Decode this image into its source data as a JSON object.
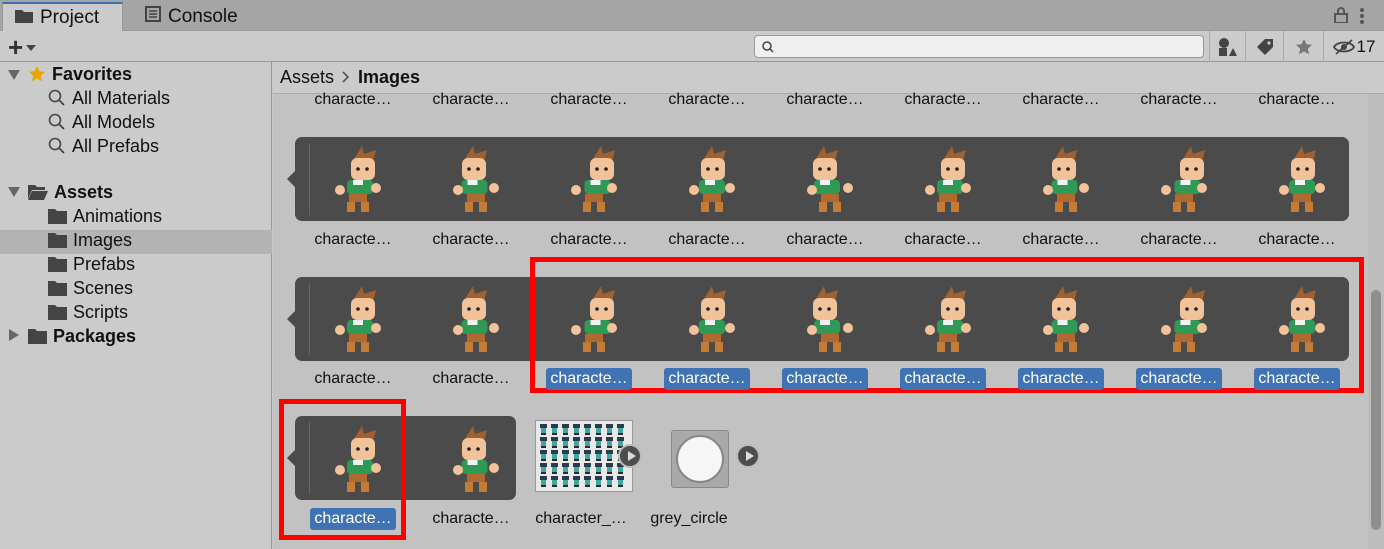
{
  "tabs": {
    "project": "Project",
    "console": "Console"
  },
  "toolbar": {
    "create_symbol": "+",
    "hidden_count": "17"
  },
  "search": {
    "placeholder": ""
  },
  "sidebar": {
    "favorites": {
      "label": "Favorites",
      "items": [
        "All Materials",
        "All Models",
        "All Prefabs"
      ]
    },
    "assets": {
      "label": "Assets",
      "items": [
        "Animations",
        "Images",
        "Prefabs",
        "Scenes",
        "Scripts"
      ]
    },
    "packages": {
      "label": "Packages"
    }
  },
  "breadcrumb": {
    "root": "Assets",
    "current": "Images"
  },
  "grid": {
    "row0_labels": [
      "characte…",
      "characte…",
      "characte…",
      "characte…",
      "characte…",
      "characte…",
      "characte…",
      "characte…",
      "characte…"
    ],
    "row1_labels": [
      "characte…",
      "characte…",
      "characte…",
      "characte…",
      "characte…",
      "characte…",
      "characte…",
      "characte…",
      "characte…"
    ],
    "row2_labels": [
      "characte…",
      "characte…",
      "characte…",
      "characte…",
      "characte…",
      "characte…",
      "characte…",
      "characte…",
      "characte…"
    ],
    "row3_labels": [
      "characte…",
      "characte…",
      "character_…",
      "grey_circle"
    ]
  },
  "colors": {
    "selection": "#3f73b4",
    "highlight": "#ff0000",
    "strip": "#4b4b4b"
  }
}
